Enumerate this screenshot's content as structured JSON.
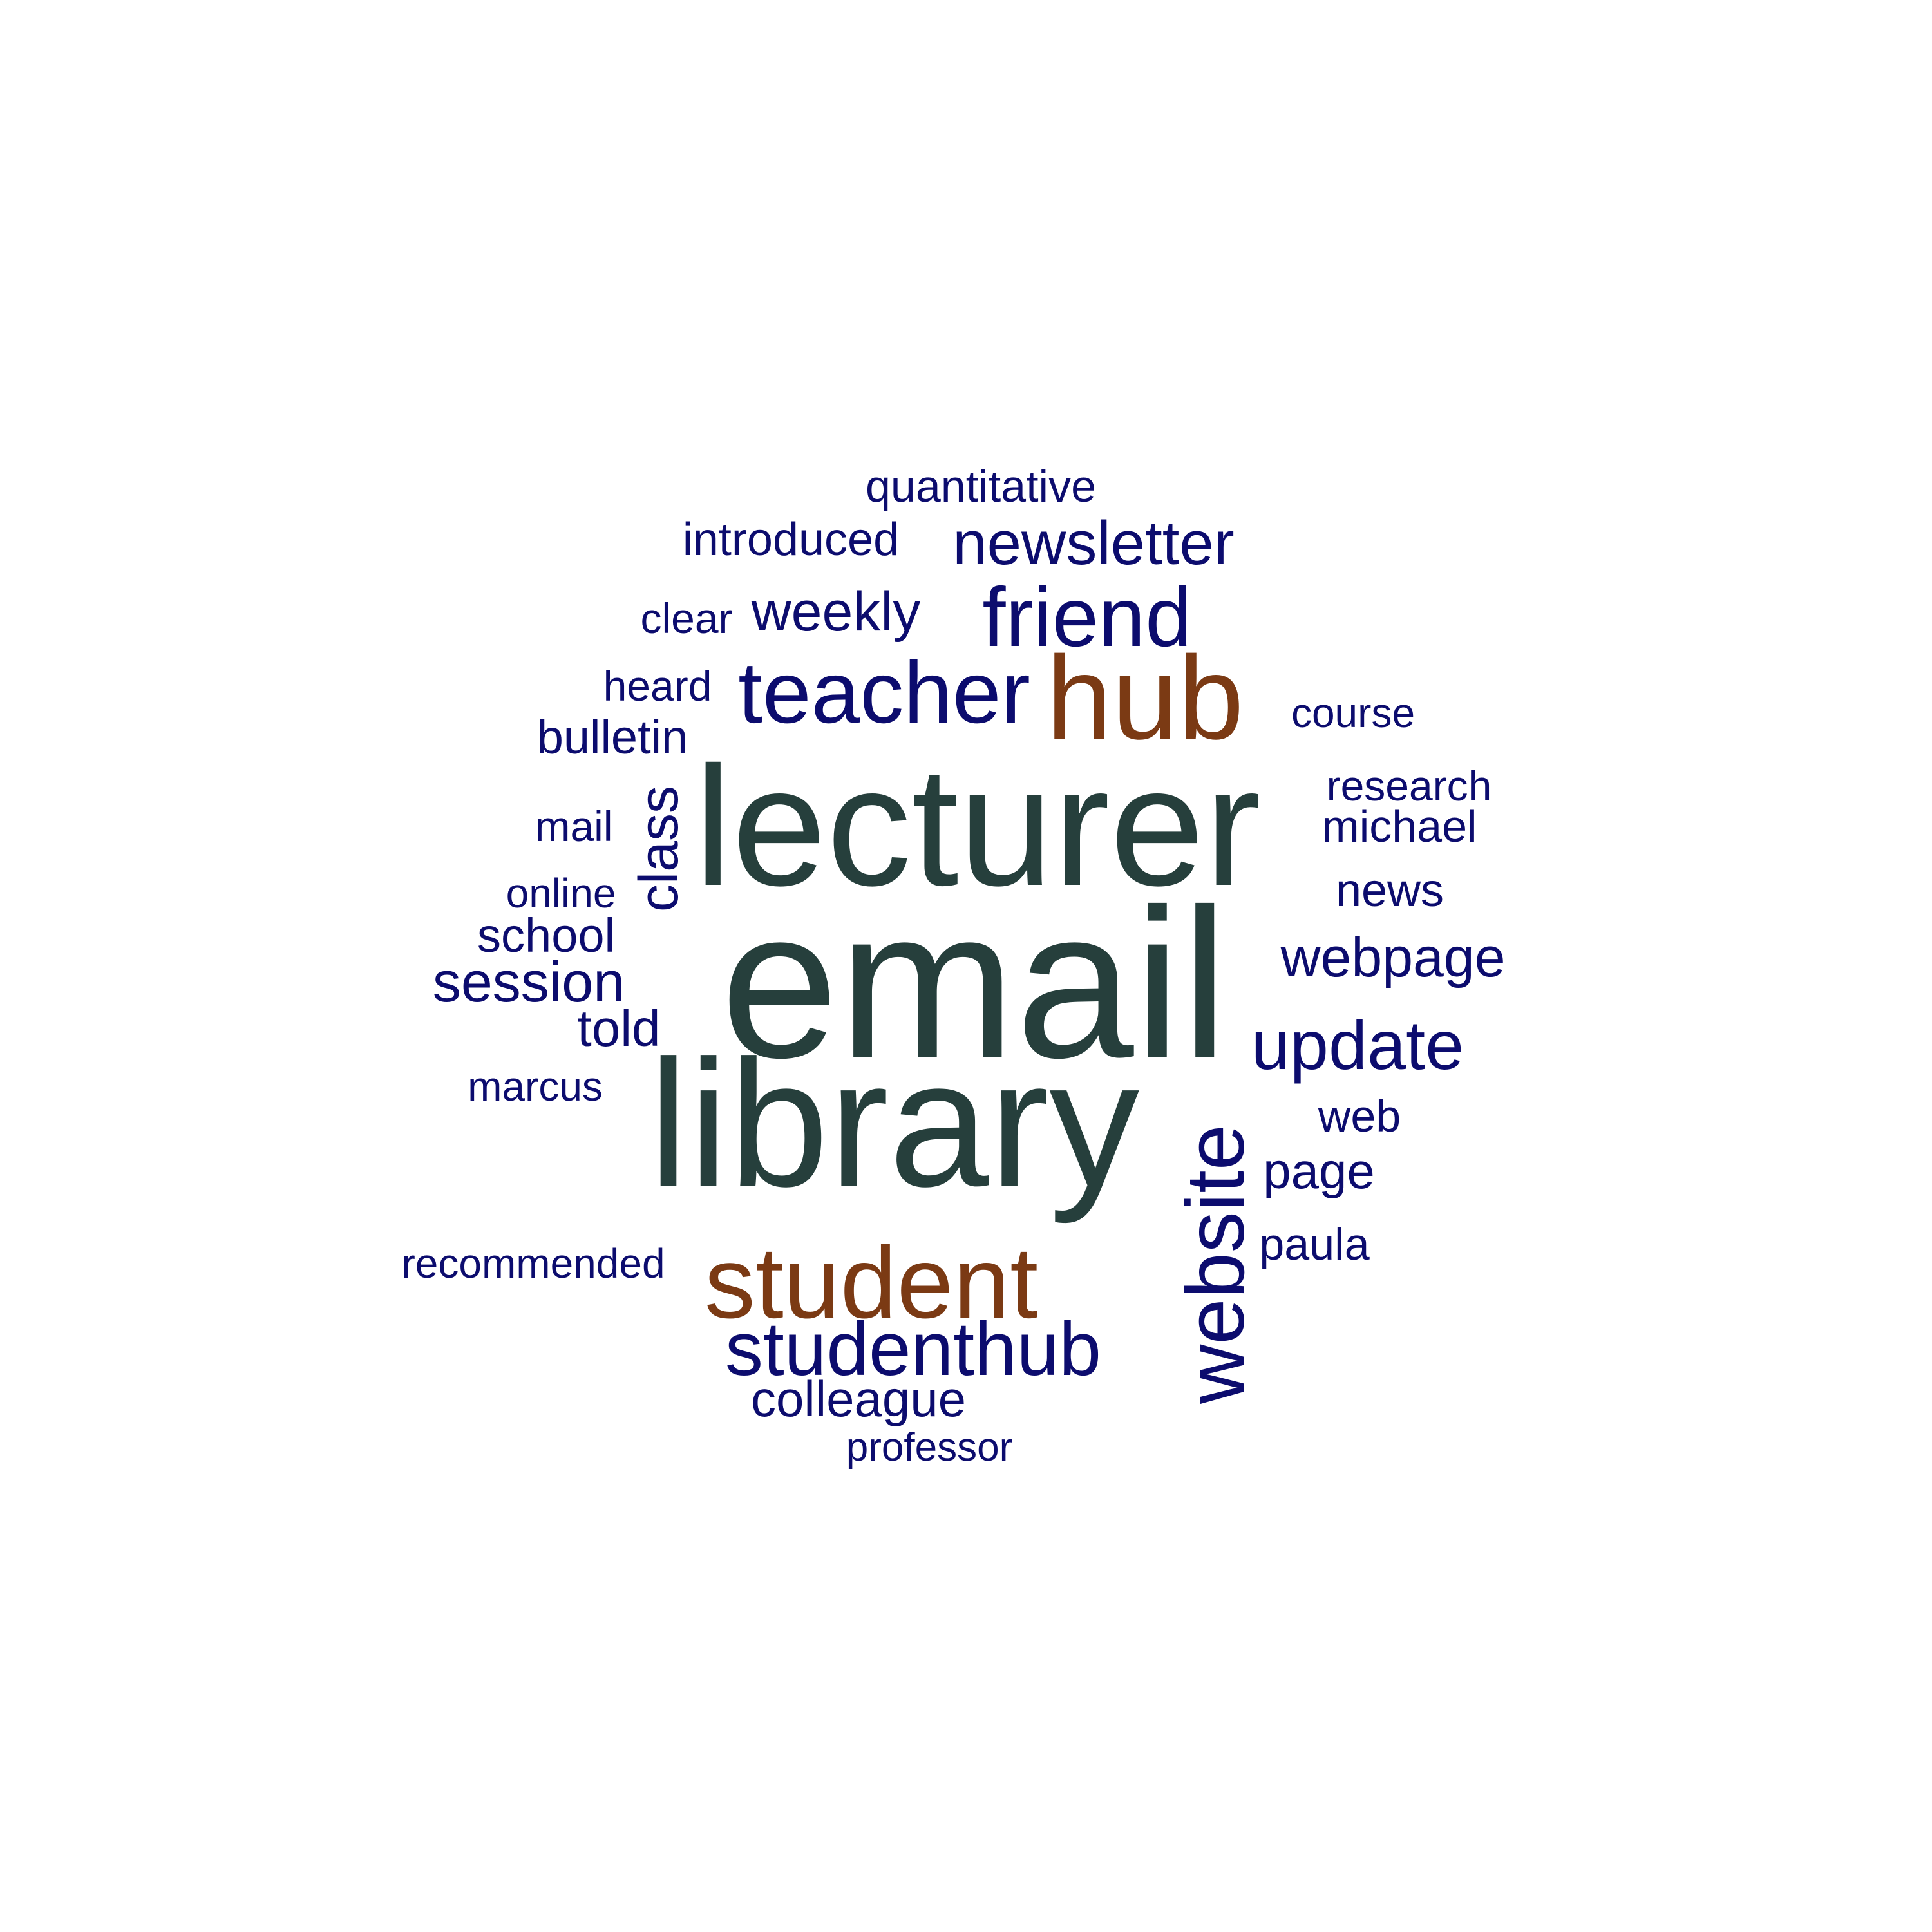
{
  "palette": {
    "navy": "#0c0c6e",
    "slate": "#263f3c",
    "brown": "#7b3a14",
    "background": "#ffffff"
  },
  "words": [
    {
      "id": "email",
      "text": "email",
      "color": "slate"
    },
    {
      "id": "lecturer",
      "text": "lecturer",
      "color": "slate"
    },
    {
      "id": "library",
      "text": "library",
      "color": "slate"
    },
    {
      "id": "hub",
      "text": "hub",
      "color": "brown"
    },
    {
      "id": "student",
      "text": "student",
      "color": "brown"
    },
    {
      "id": "teacher",
      "text": "teacher",
      "color": "navy"
    },
    {
      "id": "friend",
      "text": "friend",
      "color": "navy"
    },
    {
      "id": "website",
      "text": "website",
      "color": "navy",
      "vertical": true
    },
    {
      "id": "studenthub",
      "text": "studenthub",
      "color": "navy"
    },
    {
      "id": "update",
      "text": "update",
      "color": "navy"
    },
    {
      "id": "newsletter",
      "text": "newsletter",
      "color": "navy"
    },
    {
      "id": "webpage",
      "text": "webpage",
      "color": "navy"
    },
    {
      "id": "session",
      "text": "session",
      "color": "navy"
    },
    {
      "id": "weekly",
      "text": "weekly",
      "color": "navy"
    },
    {
      "id": "class",
      "text": "class",
      "color": "navy",
      "vertical": true
    },
    {
      "id": "colleague",
      "text": "colleague",
      "color": "navy"
    },
    {
      "id": "told",
      "text": "told",
      "color": "navy"
    },
    {
      "id": "page",
      "text": "page",
      "color": "navy"
    },
    {
      "id": "school",
      "text": "school",
      "color": "navy"
    },
    {
      "id": "bulletin",
      "text": "bulletin",
      "color": "navy"
    },
    {
      "id": "introduced",
      "text": "introduced",
      "color": "navy"
    },
    {
      "id": "quantitative",
      "text": "quantitative",
      "color": "navy"
    },
    {
      "id": "michael",
      "text": "michael",
      "color": "navy"
    },
    {
      "id": "news",
      "text": "news",
      "color": "navy"
    },
    {
      "id": "paula",
      "text": "paula",
      "color": "navy"
    },
    {
      "id": "web",
      "text": "web",
      "color": "navy"
    },
    {
      "id": "research",
      "text": "research",
      "color": "navy"
    },
    {
      "id": "course",
      "text": "course",
      "color": "navy"
    },
    {
      "id": "heard",
      "text": "heard",
      "color": "navy"
    },
    {
      "id": "clear",
      "text": "clear",
      "color": "navy"
    },
    {
      "id": "mail",
      "text": "mail",
      "color": "navy"
    },
    {
      "id": "online",
      "text": "online",
      "color": "navy"
    },
    {
      "id": "marcus",
      "text": "marcus",
      "color": "navy"
    },
    {
      "id": "recommended",
      "text": "recommended",
      "color": "navy"
    },
    {
      "id": "professor",
      "text": "professor",
      "color": "navy"
    }
  ]
}
